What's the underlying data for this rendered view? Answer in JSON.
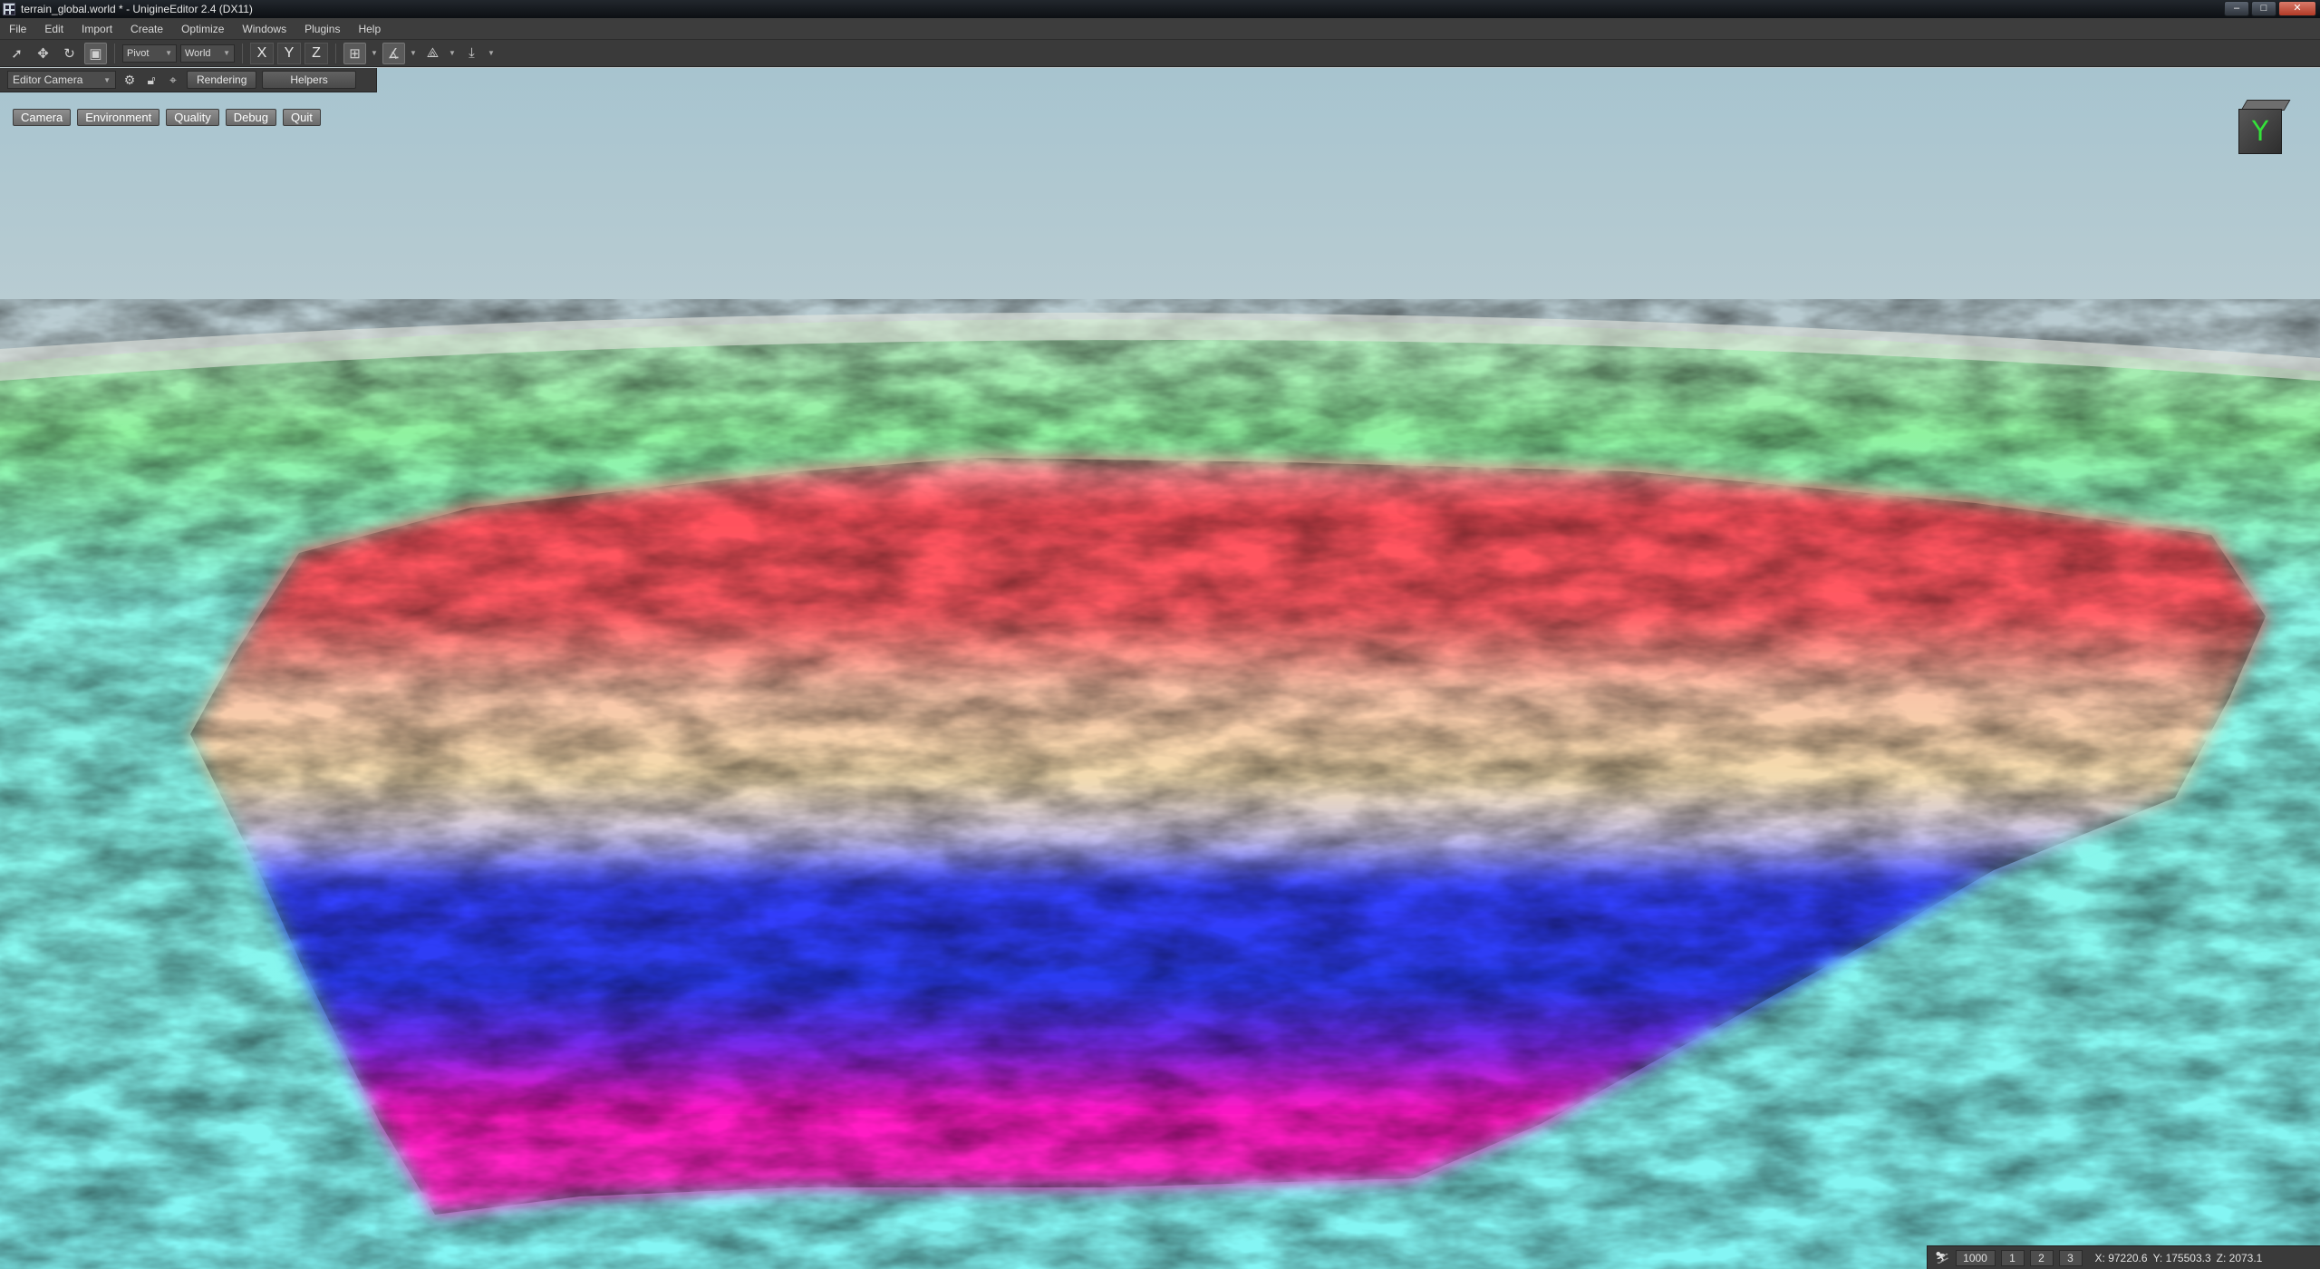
{
  "window": {
    "title": "terrain_global.world * - UnigineEditor 2.4 (DX11)",
    "controls": {
      "minimize": "–",
      "maximize": "□",
      "close": "✕"
    }
  },
  "menubar": {
    "items": [
      "File",
      "Edit",
      "Import",
      "Create",
      "Optimize",
      "Windows",
      "Plugins",
      "Help"
    ]
  },
  "toolbar": {
    "pivot_label": "Pivot",
    "space_label": "World",
    "axis_x": "X",
    "axis_y": "Y",
    "axis_z": "Z"
  },
  "toolbar2": {
    "camera_select": "Editor Camera",
    "rendering_label": "Rendering",
    "helpers_label": "Helpers"
  },
  "viewport": {
    "buttons": [
      "Camera",
      "Environment",
      "Quality",
      "Debug",
      "Quit"
    ],
    "gizmo_axis": "Y",
    "gizmo_color": "#34e23a"
  },
  "statusbar": {
    "speed": "1000",
    "speed_presets": [
      "1",
      "2",
      "3"
    ],
    "x": "X: 97220.6",
    "y": "Y: 175503.3",
    "z": "Z: 2073.1"
  },
  "colors": {
    "terrain_band_red": "#ff4f5c",
    "terrain_band_sand": "#f6dba6",
    "terrain_band_blue": "#2f3fff",
    "terrain_band_magenta": "#ff16c0",
    "surrounding_terrain": "#8df4ec",
    "horizon_green": "#8ff29f"
  }
}
